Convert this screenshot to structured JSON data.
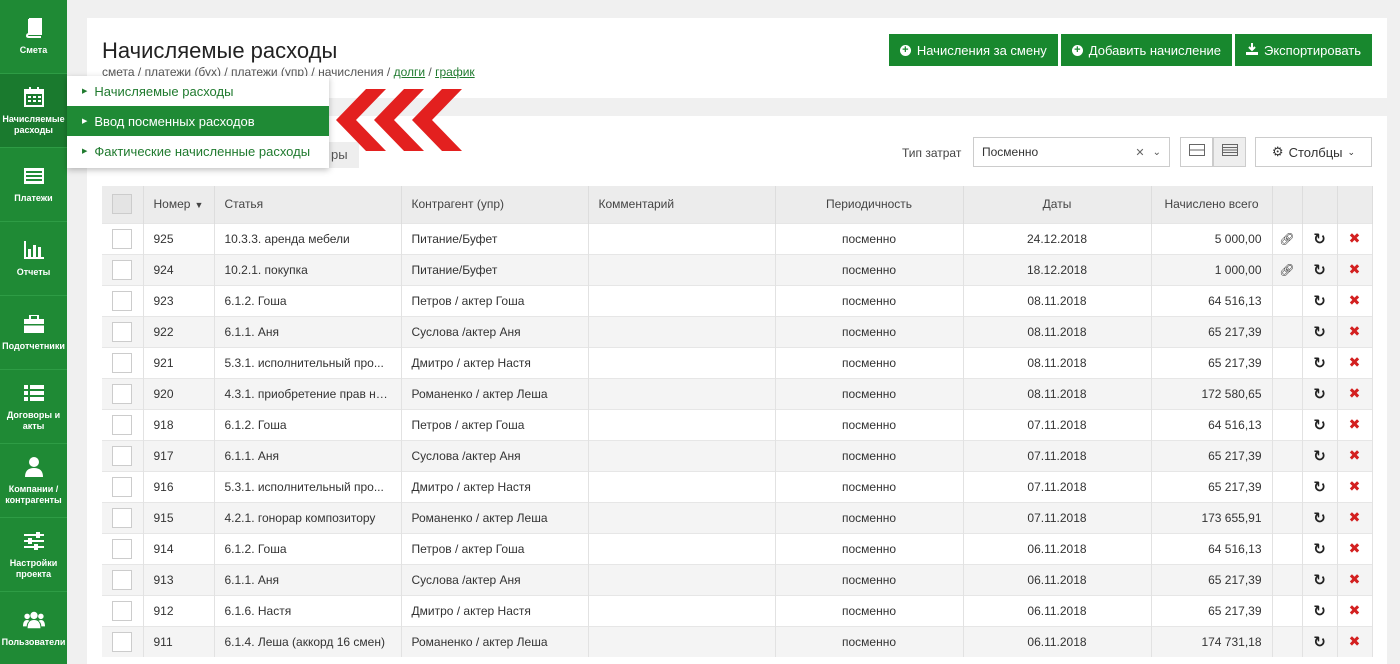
{
  "sidebar": {
    "items": [
      {
        "label": "Смета",
        "icon": "book-icon"
      },
      {
        "label": "Начисляемые расходы",
        "icon": "calendar-icon"
      },
      {
        "label": "Платежи",
        "icon": "list-icon"
      },
      {
        "label": "Отчеты",
        "icon": "bar-chart-icon"
      },
      {
        "label": "Подотчетники",
        "icon": "briefcase-icon"
      },
      {
        "label": "Договоры и акты",
        "icon": "list-bullets-icon"
      },
      {
        "label": "Компании / контрагенты",
        "icon": "user-icon"
      },
      {
        "label": "Настройки проекта",
        "icon": "sliders-icon"
      },
      {
        "label": "Пользователи",
        "icon": "users-icon"
      }
    ]
  },
  "header": {
    "title": "Начисляемые расходы",
    "breadcrumb_plain": "смета / платежи (бух) / платежи (упр) / начисления / ",
    "breadcrumb_link1": "долги",
    "breadcrumb_sep": " / ",
    "breadcrumb_link2": "график",
    "buttons": {
      "shift": "Начисления за смену",
      "add": "Добавить начисление",
      "export": "Экспортировать"
    }
  },
  "dropdown": {
    "items": [
      "Начисляемые расходы",
      "Ввод посменных расходов",
      "Фактические начисленные расходы"
    ]
  },
  "tab_stub": "ры",
  "filter": {
    "label": "Тип затрат",
    "value": "Посменно"
  },
  "columns_button": "Столбцы",
  "table": {
    "headers": [
      "Номер",
      "Статья",
      "Контрагент (упр)",
      "Комментарий",
      "Периодичность",
      "Даты",
      "Начислено всего"
    ],
    "rows": [
      {
        "num": "925",
        "article": "10.3.3. аренда мебели",
        "contractor": "Питание/Буфет",
        "comment": "",
        "period": "посменно",
        "date": "24.12.2018",
        "total": "5 000,00",
        "link": true
      },
      {
        "num": "924",
        "article": "10.2.1. покупка",
        "contractor": "Питание/Буфет",
        "comment": "",
        "period": "посменно",
        "date": "18.12.2018",
        "total": "1 000,00",
        "link": true
      },
      {
        "num": "923",
        "article": "6.1.2. Гоша",
        "contractor": "Петров / актер Гоша",
        "comment": "",
        "period": "посменно",
        "date": "08.11.2018",
        "total": "64 516,13",
        "link": false
      },
      {
        "num": "922",
        "article": "6.1.1. Аня",
        "contractor": "Суслова /актер Аня",
        "comment": "",
        "period": "посменно",
        "date": "08.11.2018",
        "total": "65 217,39",
        "link": false
      },
      {
        "num": "921",
        "article": "5.3.1. исполнительный про...",
        "contractor": "Дмитро / актер Настя",
        "comment": "",
        "period": "посменно",
        "date": "08.11.2018",
        "total": "65 217,39",
        "link": false
      },
      {
        "num": "920",
        "article": "4.3.1. приобретение прав на...",
        "contractor": "Романенко / актер Леша",
        "comment": "",
        "period": "посменно",
        "date": "08.11.2018",
        "total": "172 580,65",
        "link": false
      },
      {
        "num": "918",
        "article": "6.1.2. Гоша",
        "contractor": "Петров / актер Гоша",
        "comment": "",
        "period": "посменно",
        "date": "07.11.2018",
        "total": "64 516,13",
        "link": false
      },
      {
        "num": "917",
        "article": "6.1.1. Аня",
        "contractor": "Суслова /актер Аня",
        "comment": "",
        "period": "посменно",
        "date": "07.11.2018",
        "total": "65 217,39",
        "link": false
      },
      {
        "num": "916",
        "article": "5.3.1. исполнительный про...",
        "contractor": "Дмитро / актер Настя",
        "comment": "",
        "period": "посменно",
        "date": "07.11.2018",
        "total": "65 217,39",
        "link": false
      },
      {
        "num": "915",
        "article": "4.2.1. гонорар композитору",
        "contractor": "Романенко / актер Леша",
        "comment": "",
        "period": "посменно",
        "date": "07.11.2018",
        "total": "173 655,91",
        "link": false
      },
      {
        "num": "914",
        "article": "6.1.2. Гоша",
        "contractor": "Петров / актер Гоша",
        "comment": "",
        "period": "посменно",
        "date": "06.11.2018",
        "total": "64 516,13",
        "link": false
      },
      {
        "num": "913",
        "article": "6.1.1. Аня",
        "contractor": "Суслова /актер Аня",
        "comment": "",
        "period": "посменно",
        "date": "06.11.2018",
        "total": "65 217,39",
        "link": false
      },
      {
        "num": "912",
        "article": "6.1.6. Настя",
        "contractor": "Дмитро / актер Настя",
        "comment": "",
        "period": "посменно",
        "date": "06.11.2018",
        "total": "65 217,39",
        "link": false
      },
      {
        "num": "911",
        "article": "6.1.4. Леша (аккорд 16 смен)",
        "contractor": "Романенко / актер Леша",
        "comment": "",
        "period": "посменно",
        "date": "06.11.2018",
        "total": "174 731,18",
        "link": false
      }
    ]
  },
  "colors": {
    "brand_green": "#1f8a35",
    "button_green": "#18882e",
    "delete_red": "#d32020",
    "arrow_red": "#e3201f"
  }
}
